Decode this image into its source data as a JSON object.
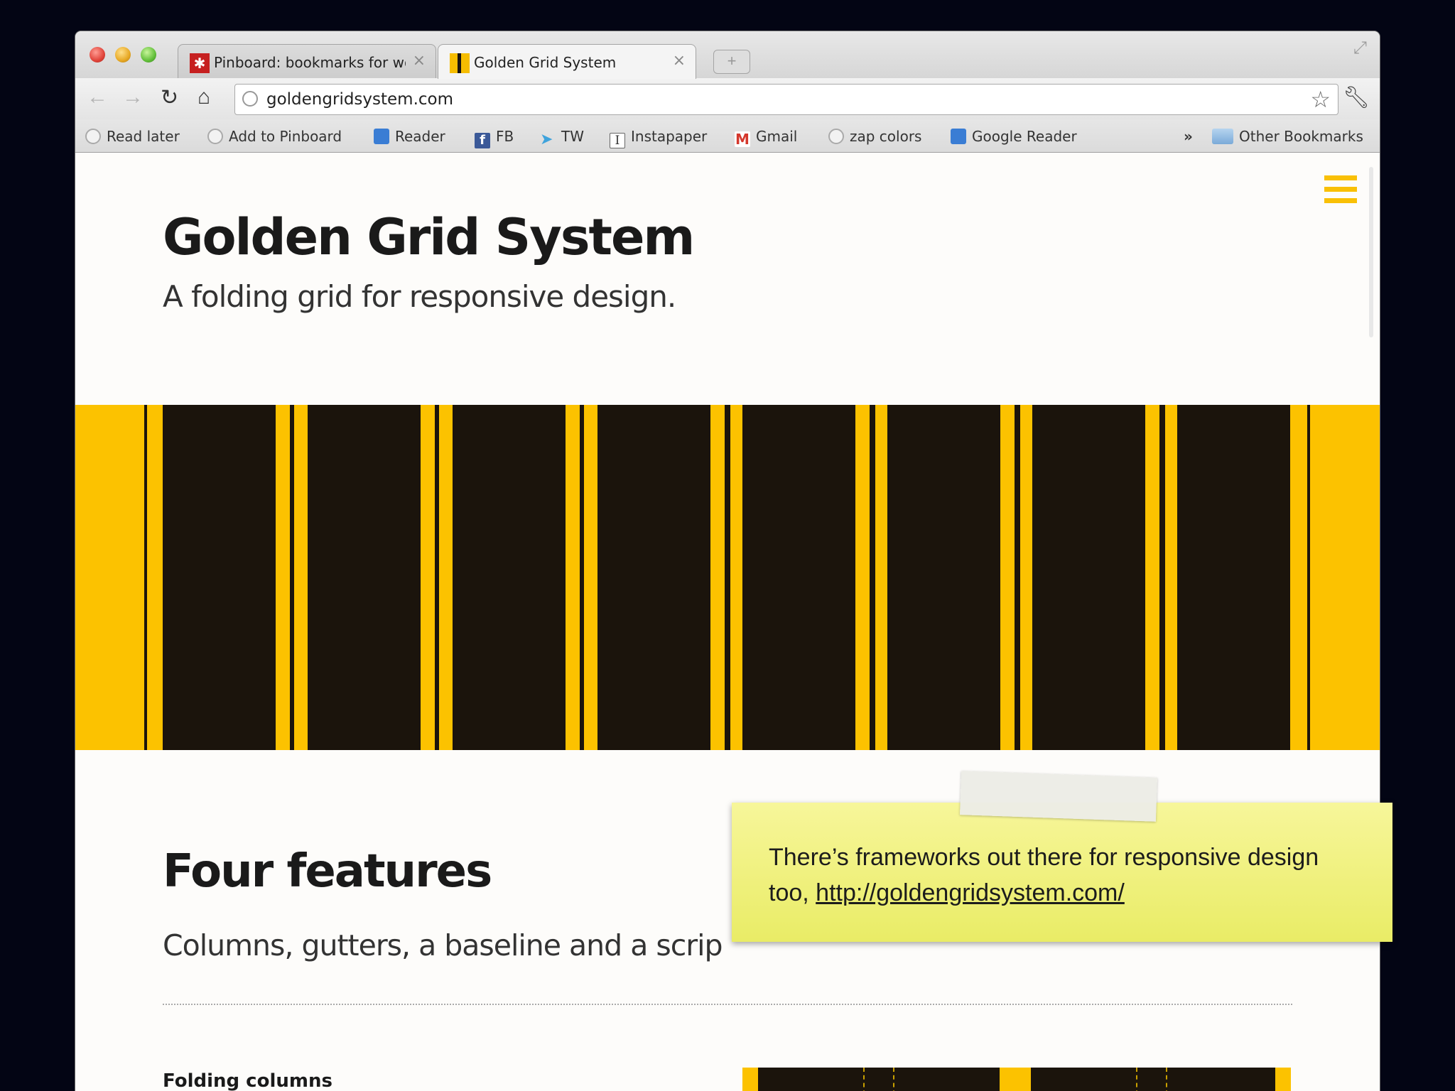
{
  "browser": {
    "tabs": [
      {
        "label": "Pinboard: bookmarks for wo",
        "favicon": "pinboard-icon",
        "active": false
      },
      {
        "label": "Golden Grid System",
        "favicon": "golden-grid-icon",
        "active": true
      }
    ],
    "close_glyph": "×",
    "address": "goldengridsystem.com",
    "bookmarks": [
      {
        "label": "Read later",
        "icon": "globe-icon"
      },
      {
        "label": "Add to Pinboard",
        "icon": "globe-icon"
      },
      {
        "label": "Reader",
        "icon": "reader-icon"
      },
      {
        "label": "FB",
        "icon": "facebook-icon"
      },
      {
        "label": "TW",
        "icon": "twitter-icon"
      },
      {
        "label": "Instapaper",
        "icon": "instapaper-icon"
      },
      {
        "label": "Gmail",
        "icon": "gmail-icon"
      },
      {
        "label": "zap colors",
        "icon": "globe-icon"
      },
      {
        "label": "Google Reader",
        "icon": "reader-icon"
      }
    ],
    "overflow_label": "»",
    "other_bookmarks": "Other Bookmarks"
  },
  "page": {
    "title": "Golden Grid System",
    "subtitle": "A folding grid for responsive design.",
    "section_title": "Four features",
    "section_subtitle": "Columns, gutters, a baseline and a scrip",
    "feature_title": "Folding columns"
  },
  "note": {
    "text": "There’s frameworks out there for responsive design too, ",
    "link": "http://goldengridsystem.com/"
  },
  "colors": {
    "accent_yellow": "#fcc200",
    "column_dark": "#1b140c",
    "note_yellow": "#f2f28a",
    "background": "#030514"
  }
}
